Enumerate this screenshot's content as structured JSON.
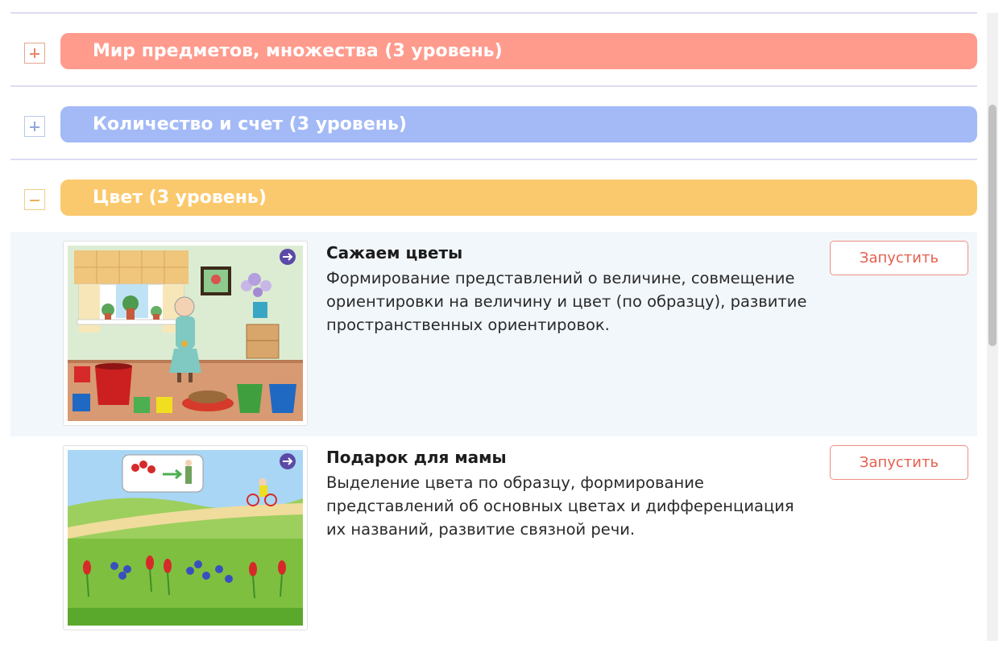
{
  "sections": [
    {
      "title": "Мир предметов, множества (3 уровень)",
      "toggle": "+",
      "color": "#ff9b8d",
      "expanded": false
    },
    {
      "title": "Количество и счет (3 уровень)",
      "toggle": "+",
      "color": "#a3baf7",
      "expanded": false
    },
    {
      "title": "Цвет (3 уровень)",
      "toggle": "−",
      "color": "#fbc96d",
      "expanded": true
    }
  ],
  "games": [
    {
      "title": "Сажаем цветы",
      "description": "Формирование представлений о величине, совмещение ориентировки на величину и цвет (по образцу), развитие пространственных ориентировок.",
      "button_label": "Запустить",
      "highlighted": true
    },
    {
      "title": "Подарок для мамы",
      "description": "Выделение цвета по образцу, формирование представлений об основных цветах и дифференциация их названий, развитие связной речи.",
      "button_label": "Запустить",
      "highlighted": false
    }
  ],
  "icons": {
    "expand": "plus-icon",
    "collapse": "minus-icon",
    "play": "arrow-circle-icon"
  }
}
